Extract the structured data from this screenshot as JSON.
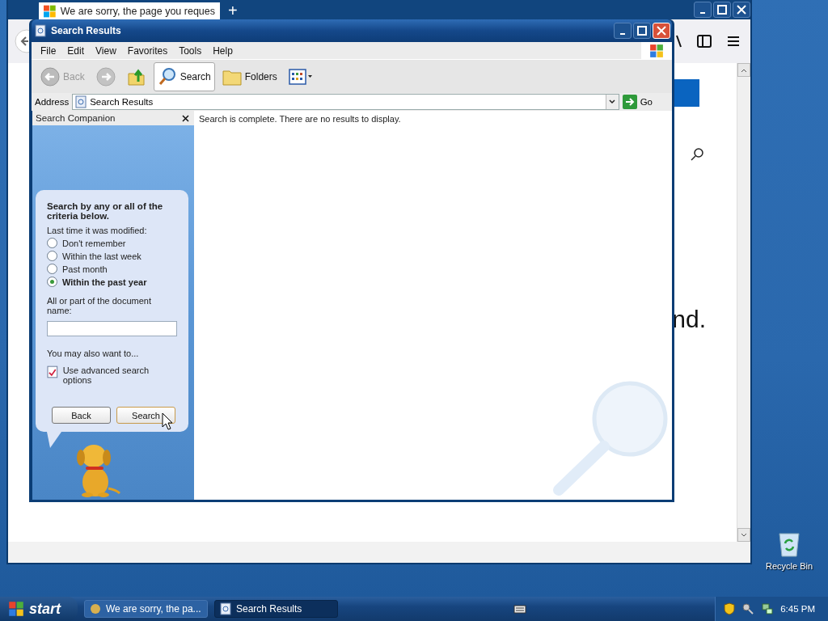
{
  "browser": {
    "tab_title": "We are sorry, the page you reques",
    "new_tab": "+",
    "page_text": "nd."
  },
  "window": {
    "title": "Search Results",
    "menu": [
      "File",
      "Edit",
      "View",
      "Favorites",
      "Tools",
      "Help"
    ],
    "toolbar": [
      {
        "kind": "back",
        "label": "Back",
        "disabled": true,
        "selected": false
      },
      {
        "kind": "forward",
        "disabled": true,
        "selected": false
      },
      {
        "kind": "up",
        "disabled": false,
        "selected": false
      },
      {
        "kind": "search",
        "label": "Search",
        "disabled": false,
        "selected": true
      },
      {
        "kind": "folders",
        "label": "Folders",
        "disabled": false,
        "selected": false
      },
      {
        "kind": "views",
        "disabled": false,
        "selected": false
      }
    ],
    "address": {
      "label": "Address",
      "value": "Search Results",
      "go": "Go"
    },
    "message": "Search is complete. There are no results to display."
  },
  "companion": {
    "title": "Search Companion",
    "heading": "Search by any or all of the criteria below.",
    "criteria_label": "Last time it was modified:",
    "options": [
      {
        "label": "Don't remember",
        "selected": false
      },
      {
        "label": "Within the last week",
        "selected": false
      },
      {
        "label": "Past month",
        "selected": false
      },
      {
        "label": "Within the past year",
        "selected": true
      }
    ],
    "name_label": "All or part of the document name:",
    "also_label": "You may also want to...",
    "links": [
      {
        "label": "Use advanced search options"
      }
    ],
    "buttons": [
      "Back",
      "Search"
    ]
  },
  "desktop_icons": [
    {
      "label": "Recycle Bin"
    }
  ],
  "taskbar": {
    "start": "start",
    "tasks": [
      {
        "label": "We are sorry, the pa...",
        "selected": false
      },
      {
        "label": "Search Results",
        "selected": true
      }
    ],
    "clock": "6:45 PM"
  }
}
